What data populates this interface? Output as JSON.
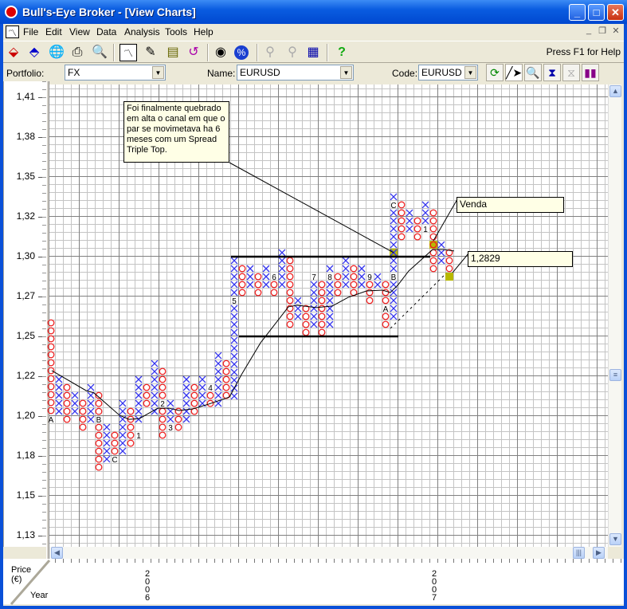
{
  "window": {
    "title": "Bull's-Eye Broker - [View Charts]",
    "min": "_",
    "max": "□",
    "close": "✕"
  },
  "menu": [
    "File",
    "Edit",
    "View",
    "Data",
    "Analysis",
    "Tools",
    "Help"
  ],
  "toolbar": {
    "help_text": "Press F1 for Help"
  },
  "filters": {
    "portfolio_label": "Portfolio:",
    "portfolio_value": "FX",
    "name_label": "Name:",
    "name_value": "EURUSD",
    "code_label": "Code:",
    "code_value": "EURUSD"
  },
  "axis": {
    "price_label": "Price",
    "currency_label": "(€)",
    "year_label": "Year",
    "years": [
      "2006",
      "2007"
    ]
  },
  "annotations": {
    "note": "Foi finalmente quebrado em alta o canal em que o par se movimetava ha 6 meses com um Spread Triple Top.",
    "sell": "Venda",
    "price": "1,2829"
  },
  "chart_data": {
    "type": "point-and-figure",
    "symbol": "EURUSD",
    "ylim": [
      1.13,
      1.41
    ],
    "y_tick_labels": [
      "1,41",
      "1,38",
      "1,35",
      "1,32",
      "1,30",
      "1,27",
      "1,25",
      "1,22",
      "1,20",
      "1,18",
      "1,15",
      "1,13"
    ],
    "columns": [
      {
        "t": "O",
        "hi": 1.2639,
        "n": 12
      },
      {
        "t": "X",
        "hi": 1.2279,
        "n": 5
      },
      {
        "t": "O",
        "hi": 1.2228,
        "n": 5
      },
      {
        "t": "X",
        "hi": 1.2177,
        "n": 3
      },
      {
        "t": "O",
        "hi": 1.2127,
        "n": 4
      },
      {
        "t": "X",
        "hi": 1.2228,
        "n": 5
      },
      {
        "t": "O",
        "hi": 1.2177,
        "n": 10
      },
      {
        "t": "X",
        "hi": 1.1975,
        "n": 5
      },
      {
        "t": "O",
        "hi": 1.1924,
        "n": 3
      },
      {
        "t": "X",
        "hi": 1.2127,
        "n": 7
      },
      {
        "t": "O",
        "hi": 1.2076,
        "n": 5
      },
      {
        "t": "X",
        "hi": 1.2279,
        "n": 6
      },
      {
        "t": "O",
        "hi": 1.2228,
        "n": 3
      },
      {
        "t": "X",
        "hi": 1.238,
        "n": 7
      },
      {
        "t": "O",
        "hi": 1.233,
        "n": 9
      },
      {
        "t": "X",
        "hi": 1.2127,
        "n": 3
      },
      {
        "t": "O",
        "hi": 1.2076,
        "n": 3
      },
      {
        "t": "X",
        "hi": 1.2279,
        "n": 6
      },
      {
        "t": "O",
        "hi": 1.2228,
        "n": 4
      },
      {
        "t": "X",
        "hi": 1.2279,
        "n": 4
      },
      {
        "t": "O",
        "hi": 1.2177,
        "n": 2
      },
      {
        "t": "X",
        "hi": 1.2431,
        "n": 7
      },
      {
        "t": "O",
        "hi": 1.238,
        "n": 5
      },
      {
        "t": "X",
        "hi": 1.3035,
        "n": 18
      },
      {
        "t": "O",
        "hi": 1.2984,
        "n": 4
      },
      {
        "t": "X",
        "hi": 1.2984,
        "n": 3
      },
      {
        "t": "O",
        "hi": 1.2933,
        "n": 3
      },
      {
        "t": "X",
        "hi": 1.2984,
        "n": 3
      },
      {
        "t": "O",
        "hi": 1.2883,
        "n": 2
      },
      {
        "t": "X",
        "hi": 1.3086,
        "n": 5
      },
      {
        "t": "O",
        "hi": 1.3035,
        "n": 9
      },
      {
        "t": "X",
        "hi": 1.2781,
        "n": 3
      },
      {
        "t": "O",
        "hi": 1.273,
        "n": 4
      },
      {
        "t": "X",
        "hi": 1.2883,
        "n": 6
      },
      {
        "t": "O",
        "hi": 1.2883,
        "n": 7
      },
      {
        "t": "X",
        "hi": 1.2984,
        "n": 8
      },
      {
        "t": "O",
        "hi": 1.2933,
        "n": 3
      },
      {
        "t": "X",
        "hi": 1.3035,
        "n": 4
      },
      {
        "t": "O",
        "hi": 1.2984,
        "n": 4
      },
      {
        "t": "X",
        "hi": 1.2984,
        "n": 3
      },
      {
        "t": "O",
        "hi": 1.2883,
        "n": 3
      },
      {
        "t": "X",
        "hi": 1.2933,
        "n": 2
      },
      {
        "t": "O",
        "hi": 1.2883,
        "n": 6
      },
      {
        "t": "X",
        "hi": 1.3441,
        "n": 16
      },
      {
        "t": "O",
        "hi": 1.339,
        "n": 5
      },
      {
        "t": "X",
        "hi": 1.3339,
        "n": 3
      },
      {
        "t": "O",
        "hi": 1.3288,
        "n": 3
      },
      {
        "t": "X",
        "hi": 1.339,
        "n": 3
      },
      {
        "t": "O",
        "hi": 1.3339,
        "n": 8
      },
      {
        "t": "X",
        "hi": 1.3136,
        "n": 3
      },
      {
        "t": "O",
        "hi": 1.3086,
        "n": 3
      }
    ],
    "box_size": 0.00507,
    "month_markers": [
      {
        "col": 0,
        "p": 1.2025,
        "text": "A"
      },
      {
        "col": 6,
        "p": 1.2025,
        "text": "B"
      },
      {
        "col": 8,
        "p": 1.1772,
        "text": "C"
      },
      {
        "col": 11,
        "p": 1.1924,
        "text": "1"
      },
      {
        "col": 14,
        "p": 1.2127,
        "text": "2"
      },
      {
        "col": 15,
        "p": 1.1975,
        "text": "3"
      },
      {
        "col": 20,
        "p": 1.2228,
        "text": "4"
      },
      {
        "col": 23,
        "p": 1.2781,
        "text": "5"
      },
      {
        "col": 28,
        "p": 1.2933,
        "text": "6"
      },
      {
        "col": 33,
        "p": 1.2933,
        "text": "7"
      },
      {
        "col": 35,
        "p": 1.2933,
        "text": "8"
      },
      {
        "col": 40,
        "p": 1.2933,
        "text": "9"
      },
      {
        "col": 42,
        "p": 1.273,
        "text": "A"
      },
      {
        "col": 43,
        "p": 1.2933,
        "text": "B"
      },
      {
        "col": 43,
        "p": 1.339,
        "text": "C"
      },
      {
        "col": 47,
        "p": 1.3238,
        "text": "1"
      }
    ],
    "highlights": [
      {
        "col": 43,
        "p": 1.3086,
        "t": "X"
      },
      {
        "col": 48,
        "p": 1.3136,
        "t": "O"
      },
      {
        "col": 50,
        "p": 1.2933,
        "t": ""
      }
    ],
    "channel": [
      {
        "p": 1.306,
        "from": 22.6,
        "to": 47.6
      },
      {
        "p": 1.2553,
        "from": 23.6,
        "to": 43.6
      }
    ],
    "trend_line": [
      [
        0.1,
        1.2335
      ],
      [
        4.4,
        1.2208
      ],
      [
        5.4,
        1.2193
      ],
      [
        8.6,
        1.2051
      ],
      [
        9.8,
        1.2025
      ],
      [
        11.1,
        1.203
      ],
      [
        13.4,
        1.2096
      ],
      [
        14.8,
        1.2096
      ],
      [
        16.1,
        1.2081
      ],
      [
        17.8,
        1.2091
      ],
      [
        19.8,
        1.2122
      ],
      [
        22.4,
        1.2167
      ],
      [
        23.9,
        1.2309
      ],
      [
        26.3,
        1.2512
      ],
      [
        29.8,
        1.2741
      ],
      [
        30.9,
        1.2751
      ],
      [
        33.3,
        1.2736
      ],
      [
        35.3,
        1.2746
      ],
      [
        37.3,
        1.2801
      ],
      [
        39.6,
        1.2842
      ],
      [
        41.6,
        1.2847
      ],
      [
        42.6,
        1.2832
      ],
      [
        43.6,
        1.2883
      ],
      [
        44.9,
        1.2969
      ],
      [
        46.9,
        1.306
      ],
      [
        47.9,
        1.3106
      ],
      [
        49.3,
        1.3106
      ],
      [
        50.6,
        1.3096
      ]
    ],
    "projection": [
      [
        42.6,
        1.2604
      ],
      [
        49.6,
        1.2954
      ]
    ],
    "colors": {
      "x": "#3333ee",
      "o": "#ee2222",
      "highlight": "#b8b800"
    }
  }
}
